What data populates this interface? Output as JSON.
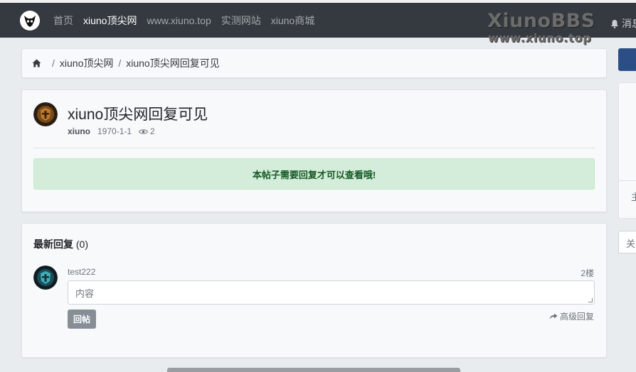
{
  "nav": {
    "links": [
      {
        "label": "首页"
      },
      {
        "label": "xiuno顶尖网"
      },
      {
        "label": "www.xiuno.top"
      },
      {
        "label": "实测网站"
      },
      {
        "label": "xiuno商城"
      }
    ],
    "active_index": 1,
    "messages_label": "消息"
  },
  "watermark": {
    "brand": "XiunoBBS",
    "url": "www.xiuno.top"
  },
  "breadcrumb": {
    "items": [
      {
        "label": "xiuno顶尖网"
      },
      {
        "label": "xiuno顶尖网回复可见"
      }
    ],
    "separator": "/"
  },
  "post": {
    "title": "xiuno顶尖网回复可见",
    "author": "xiuno",
    "date": "1970-1-1",
    "views": "2",
    "notice": "本帖子需要回复才可以查看哦!"
  },
  "replies": {
    "title": "最新回复",
    "count": "(0)",
    "user": "test222",
    "floor": "2楼",
    "input_placeholder": "内容",
    "submit_label": "回帖",
    "advanced_label": "高级回复"
  },
  "sidebar": {
    "card_text": "主",
    "search_placeholder": "关"
  },
  "colors": {
    "navbar": "#343a40",
    "alert_bg": "#d4edda",
    "alert_text": "#155724",
    "primary": "#2c4e86"
  }
}
